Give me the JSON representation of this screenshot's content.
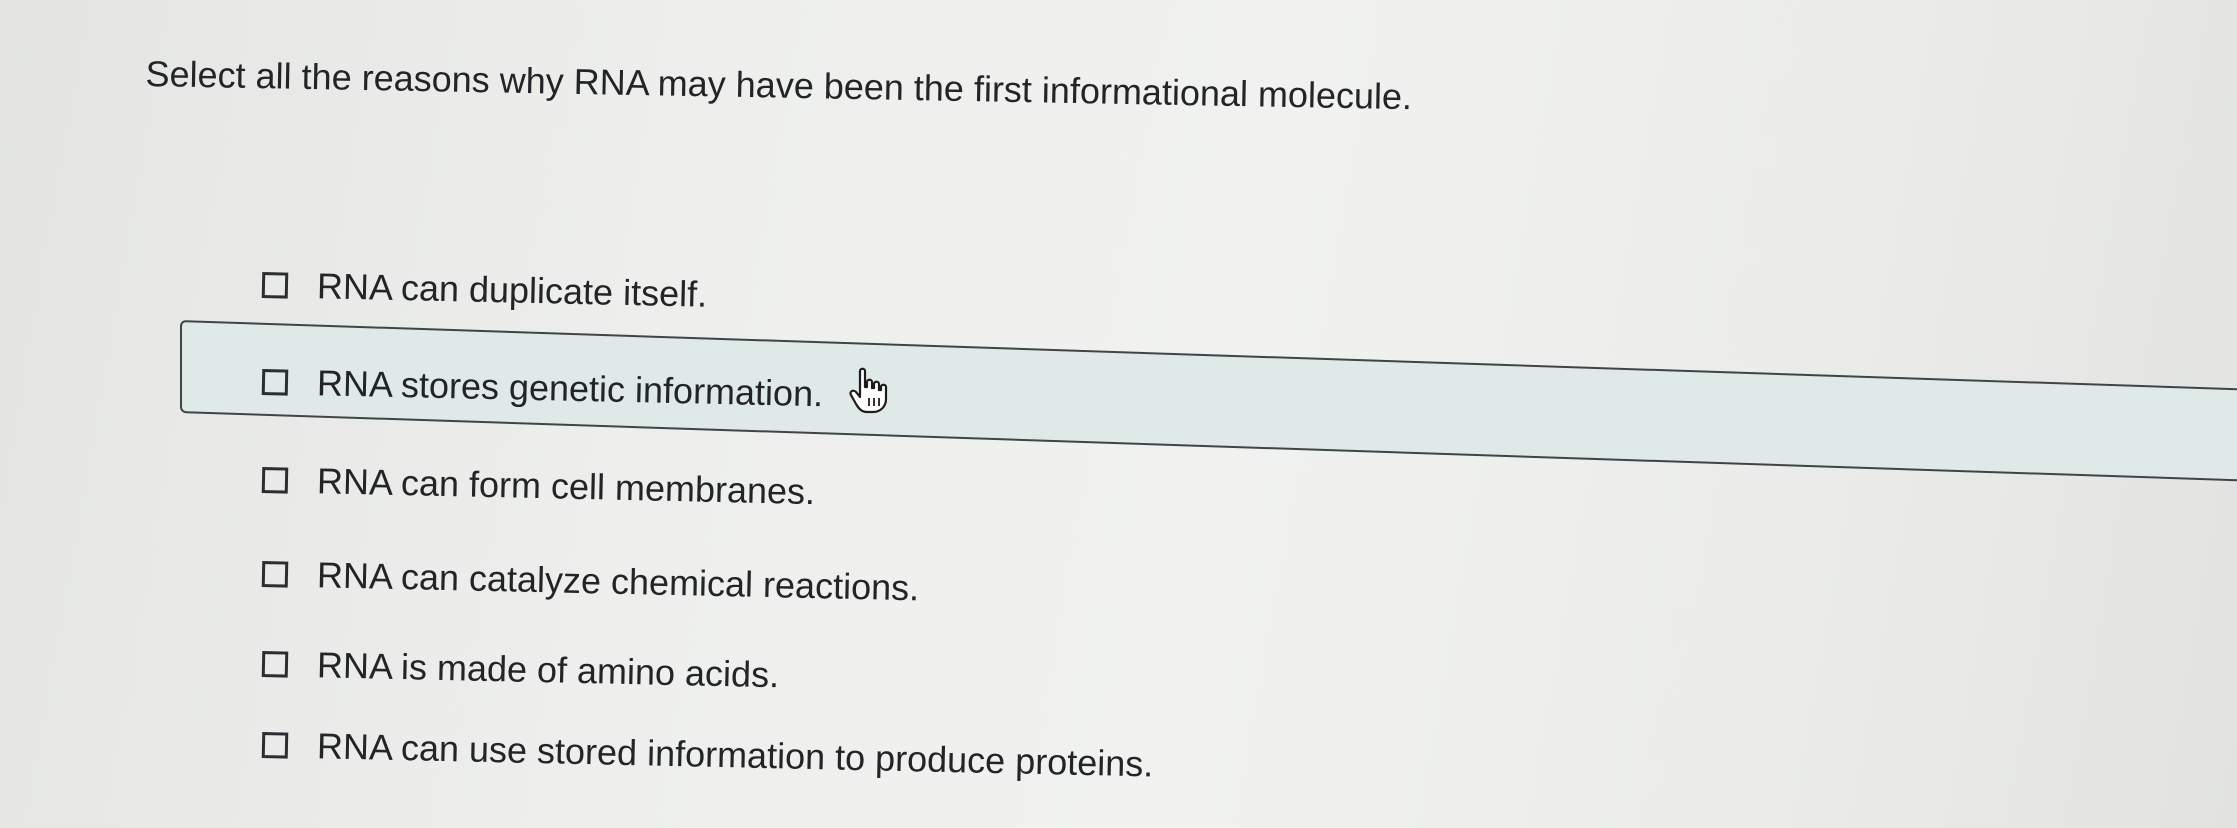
{
  "question": {
    "text": "Select all the reasons why RNA may have been the first informational molecule."
  },
  "choices": [
    {
      "label": "RNA can duplicate itself.",
      "checked": false
    },
    {
      "label": "RNA stores genetic information.",
      "checked": false,
      "hovered": true
    },
    {
      "label": "RNA can form cell membranes.",
      "checked": false
    },
    {
      "label": "RNA can catalyze chemical reactions.",
      "checked": false
    },
    {
      "label": "RNA is made of amino acids.",
      "checked": false
    },
    {
      "label": "RNA can use stored information to produce proteins.",
      "checked": false
    }
  ],
  "cursor": {
    "icon": "hand-pointer-icon"
  },
  "colors": {
    "hover_band": "#dfe9e7",
    "text": "#222427",
    "checkbox_border": "#2b2d31"
  }
}
